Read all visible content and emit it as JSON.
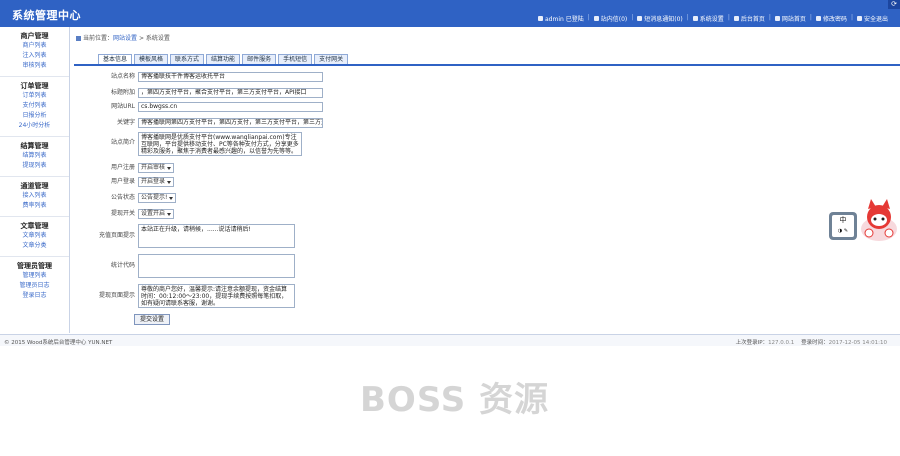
{
  "header": {
    "title": "系统管理中心",
    "corner_icon": "refresh-icon",
    "links": [
      {
        "label": "admin 已登陆",
        "icon": "user-icon"
      },
      {
        "label": "站内信(0)",
        "icon": "mail-icon"
      },
      {
        "label": "短消息通知(0)",
        "icon": "message-icon"
      },
      {
        "label": "系统设置",
        "icon": "gear-icon"
      },
      {
        "label": "后台首页",
        "icon": "home-icon"
      },
      {
        "label": "网站首页",
        "icon": "globe-icon"
      },
      {
        "label": "修改密码",
        "icon": "key-icon"
      },
      {
        "label": "安全退出",
        "icon": "logout-icon"
      }
    ]
  },
  "sidebar": {
    "groups": [
      {
        "title": "商户管理",
        "items": [
          "商户列表",
          "注入列表",
          "审核列表"
        ]
      },
      {
        "title": "订单管理",
        "items": [
          "订单列表",
          "支付列表",
          "日报分析",
          "24小时分析"
        ]
      },
      {
        "title": "结算管理",
        "items": [
          "结算列表",
          "提现列表"
        ]
      },
      {
        "title": "通道管理",
        "items": [
          "接入列表",
          "费率列表"
        ]
      },
      {
        "title": "文章管理",
        "items": [
          "文章列表",
          "文章分类"
        ]
      },
      {
        "title": "管理员管理",
        "items": [
          "管理列表",
          "管理员日志",
          "登录日志"
        ]
      }
    ]
  },
  "breadcrumb": {
    "parts": [
      "当前位置：",
      "网站设置",
      " > 系统设置"
    ]
  },
  "tabs": [
    {
      "label": "基本信息",
      "active": true
    },
    {
      "label": "模板风格",
      "active": false
    },
    {
      "label": "联系方式",
      "active": false
    },
    {
      "label": "结算功能",
      "active": false
    },
    {
      "label": "邮件服务",
      "active": false
    },
    {
      "label": "手机短信",
      "active": false
    },
    {
      "label": "支付网关",
      "active": false
    }
  ],
  "form": {
    "site_name": {
      "label": "站点名称",
      "value": "博客播联技干件博客运收托平台"
    },
    "site_title": {
      "label": "标题附加",
      "value": "，第四方支付平台，聚合支付平台，第三方支付平台，API接口"
    },
    "site_url": {
      "label": "网站URL",
      "value": "cs.bwgss.cn"
    },
    "keywords": {
      "label": "关键字",
      "value": "博客播联网第四方支付平台，第四方支付，第三方支付平台，第三方支付"
    },
    "description": {
      "label": "站点简介",
      "value": "博客播联网是优质支付平台(www.wanglianpai.com)专注互联网，平台提供移动支付、PC等各种支付方式，分享更多精彩及服务，聚焦于消费者最感兴趣的，以信誉为先等等。"
    },
    "user_register": {
      "label": "用户注册",
      "value": "开启审核"
    },
    "user_login": {
      "label": "用户登录",
      "value": "开启登录"
    },
    "notice_switch": {
      "label": "公告状态",
      "value": "公告提示!"
    },
    "withdraw": {
      "label": "提现开关",
      "value": "设置开启"
    },
    "recharge_tip": {
      "label": "充值页面提示",
      "value": "本站正在升级，请稍候，......说话请稍后!"
    },
    "stats_code": {
      "label": "统计代码",
      "value": ""
    },
    "withdraw_tip": {
      "label": "提现页面提示",
      "value": "尊敬的商户您好，温馨提示:请注意余额提现，资金结算时间：00:12:00～23:00，提现手续费按照每笔扣取，如有疑问请联系客服，谢谢。"
    },
    "submit_label": "提交设置"
  },
  "footer": {
    "copyright": "© 2015 Wood系统后台管理中心 YUN.NET",
    "last_ip_label": "上次登录IP：",
    "last_ip": "127.0.0.1",
    "last_time_label": "登录时间：",
    "last_time": "2017-12-05 14:01:10"
  },
  "widget": {
    "text": "中",
    "mascot_icon": "fox-mascot-icon"
  },
  "watermark": "BOSS 资源"
}
